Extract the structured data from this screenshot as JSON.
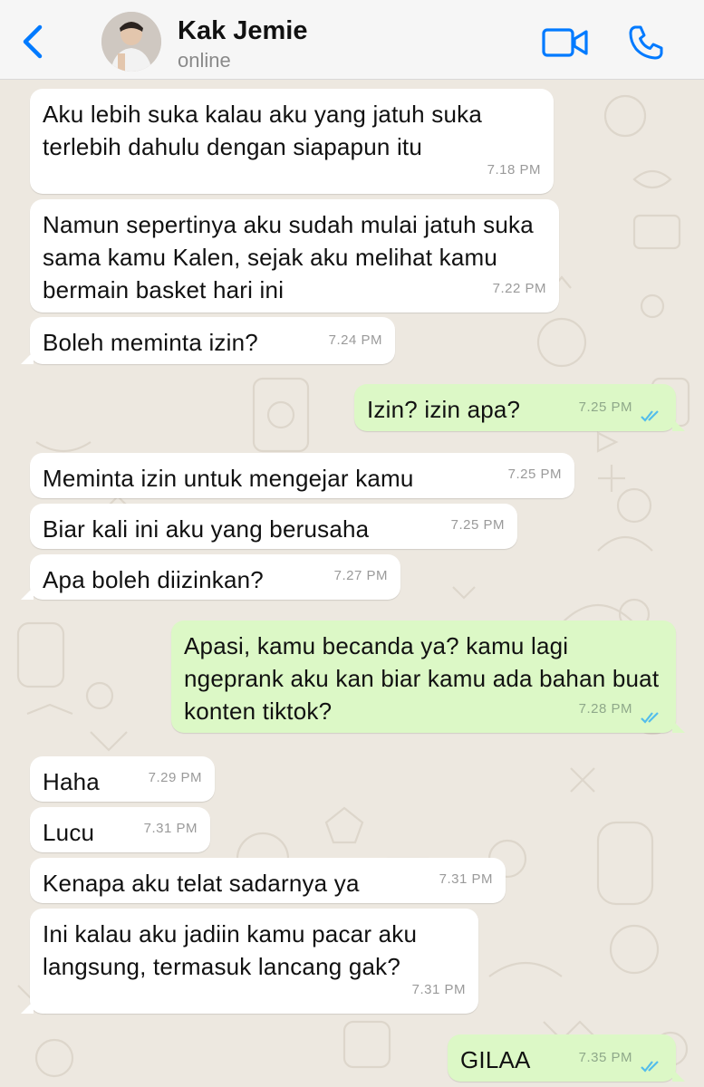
{
  "header": {
    "back_icon": "chevron-left-icon",
    "contact_name": "Kak Jemie",
    "status": "online",
    "video_icon": "video-camera-icon",
    "call_icon": "phone-icon",
    "accent": "#007aff"
  },
  "colors": {
    "incoming_bubble": "#ffffff",
    "outgoing_bubble": "#dcf8c6",
    "wallpaper": "#ede8e0",
    "read_ticks": "#53bdeb"
  },
  "messages": [
    {
      "dir": "in",
      "text": "Aku lebih suka kalau aku yang jatuh suka terlebih dahulu dengan siapapun itu",
      "time": "7.18 PM"
    },
    {
      "dir": "in",
      "text": "Namun sepertinya aku sudah mulai jatuh suka sama kamu Kalen, sejak aku melihat kamu bermain basket hari ini",
      "time": "7.22 PM"
    },
    {
      "dir": "in",
      "text": "Boleh meminta izin?",
      "time": "7.24 PM"
    },
    {
      "dir": "out",
      "text": "Izin? izin apa?",
      "time": "7.25 PM",
      "status": "read"
    },
    {
      "dir": "in",
      "text": "Meminta izin untuk mengejar kamu",
      "time": "7.25 PM"
    },
    {
      "dir": "in",
      "text": "Biar kali ini aku yang berusaha",
      "time": "7.25 PM"
    },
    {
      "dir": "in",
      "text": "Apa boleh diizinkan?",
      "time": "7.27 PM"
    },
    {
      "dir": "out",
      "text": "Apasi, kamu becanda ya? kamu lagi ngeprank aku kan biar kamu ada bahan buat konten tiktok?",
      "time": "7.28 PM",
      "status": "read"
    },
    {
      "dir": "in",
      "text": "Haha",
      "time": "7.29 PM"
    },
    {
      "dir": "in",
      "text": "Lucu",
      "time": "7.31 PM"
    },
    {
      "dir": "in",
      "text": "Kenapa aku telat sadarnya ya",
      "time": "7.31 PM"
    },
    {
      "dir": "in",
      "text": "Ini kalau aku jadiin kamu pacar aku langsung, termasuk lancang gak?",
      "time": "7.31 PM"
    },
    {
      "dir": "out",
      "text": "GILAA",
      "time": "7.35 PM",
      "status": "read"
    }
  ]
}
